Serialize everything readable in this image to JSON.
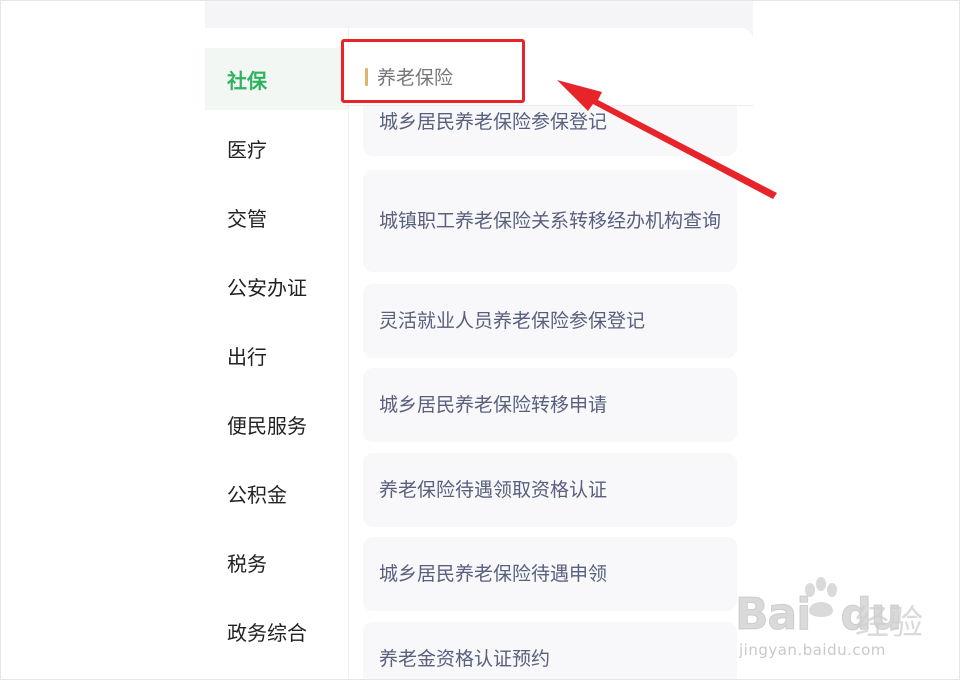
{
  "sidebar": {
    "items": [
      {
        "label": "社保",
        "active": true
      },
      {
        "label": "医疗",
        "active": false
      },
      {
        "label": "交管",
        "active": false
      },
      {
        "label": "公安办证",
        "active": false
      },
      {
        "label": "出行",
        "active": false
      },
      {
        "label": "便民服务",
        "active": false
      },
      {
        "label": "公积金",
        "active": false
      },
      {
        "label": "税务",
        "active": false
      },
      {
        "label": "政务综合",
        "active": false
      }
    ]
  },
  "section": {
    "title": "养老保险"
  },
  "services": [
    {
      "label": "城乡居民养老保险参保登记"
    },
    {
      "label": "城镇职工养老保险关系转移经办机构查询"
    },
    {
      "label": "灵活就业人员养老保险参保登记"
    },
    {
      "label": "城乡居民养老保险转移申请"
    },
    {
      "label": "养老保险待遇领取资格认证"
    },
    {
      "label": "城乡居民养老保险待遇申领"
    },
    {
      "label": "养老金资格认证预约"
    }
  ],
  "watermark": {
    "brand_latin": "Bai",
    "brand_latin_2": "du",
    "brand_cn": "经验",
    "url": "jingyan.baidu.com"
  },
  "colors": {
    "active_green": "#2fb35f",
    "annotation_red": "#e8242b",
    "section_bar": "#e0b46a",
    "card_text": "#59607e"
  }
}
